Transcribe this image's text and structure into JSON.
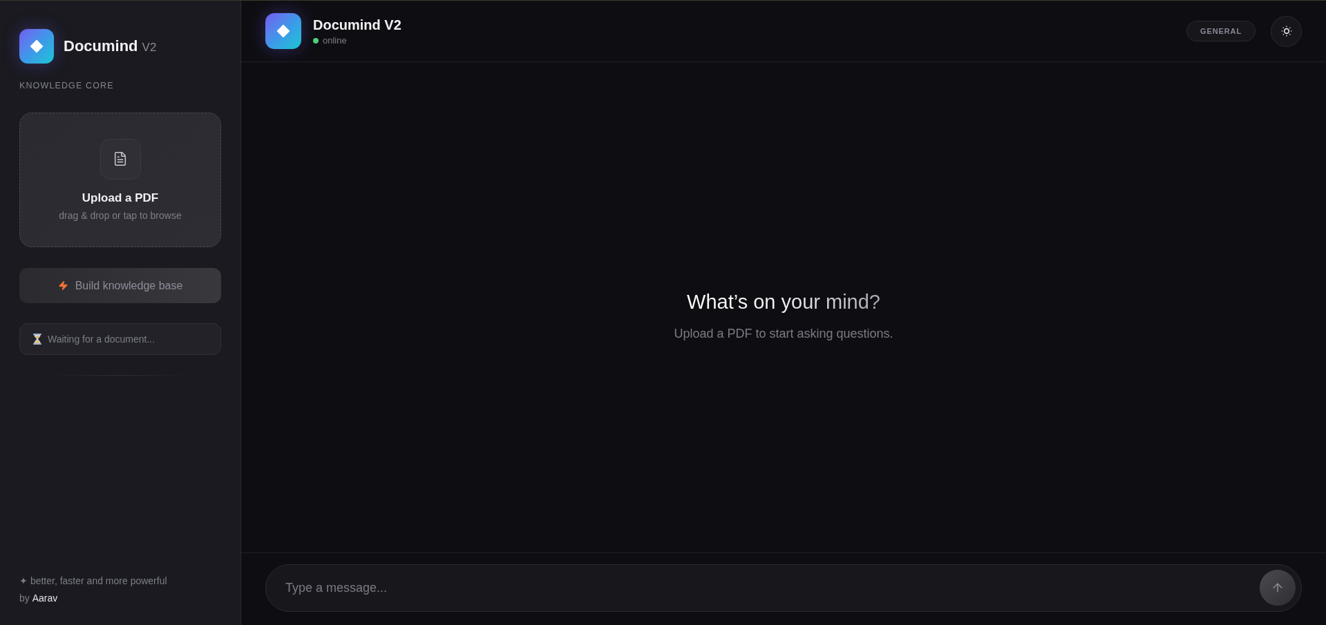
{
  "sidebar": {
    "brand": {
      "name": "Documind",
      "version": "V2"
    },
    "section_label": "KNOWLEDGE CORE",
    "upload": {
      "title": "Upload a PDF",
      "hint": "drag & drop or tap to browse"
    },
    "build_button": {
      "label": "Build knowledge base",
      "disabled": true
    },
    "status": "Waiting for a document...",
    "footer": {
      "tagline": "✦ better, faster and more powerful",
      "credit": "by **Aarav**"
    }
  },
  "header": {
    "title": "Documind V2",
    "status": "online",
    "mode_badge": "GENERAL"
  },
  "empty_state": {
    "heading": "What’s on your mind?",
    "subheading": "Upload a PDF to start asking questions."
  },
  "composer": {
    "placeholder": "Type a message...",
    "send_button": {
      "disabled": true
    }
  }
}
